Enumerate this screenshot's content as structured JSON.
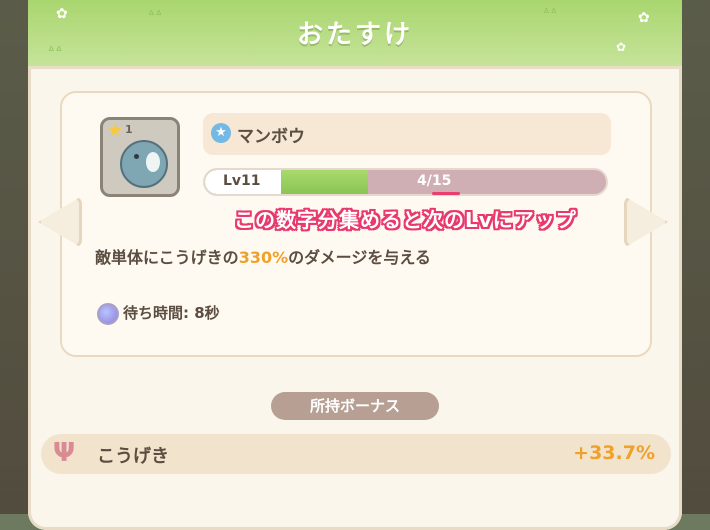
{
  "header": {
    "title": "おたすけ"
  },
  "item": {
    "star_count": "1",
    "name": "マンボウ",
    "level_label": "Lv11",
    "progress_text": "4/15",
    "progress_fraction": 0.267
  },
  "annotation": "この数字分集めると次のLvにアップ",
  "description": {
    "prefix": "敵単体にこうげきの",
    "highlight": "330%",
    "suffix": "のダメージを与える"
  },
  "wait": {
    "label": "待ち時間: 8秒"
  },
  "bonus": {
    "label": "所持ボーナス",
    "stat_name": "こうげき",
    "stat_value": "+33.7%"
  },
  "icons": {
    "star": "star-icon",
    "blue_star": "blue-star-icon",
    "fish": "sunfish-icon",
    "wait": "clock-orb-icon",
    "attack": "attack-icon",
    "left_arrow": "left-arrow-icon",
    "right_arrow": "right-arrow-icon"
  },
  "colors": {
    "header_green": "#a9d66f",
    "highlight_orange": "#f0a12b",
    "annotation_pink": "#e8386c"
  }
}
